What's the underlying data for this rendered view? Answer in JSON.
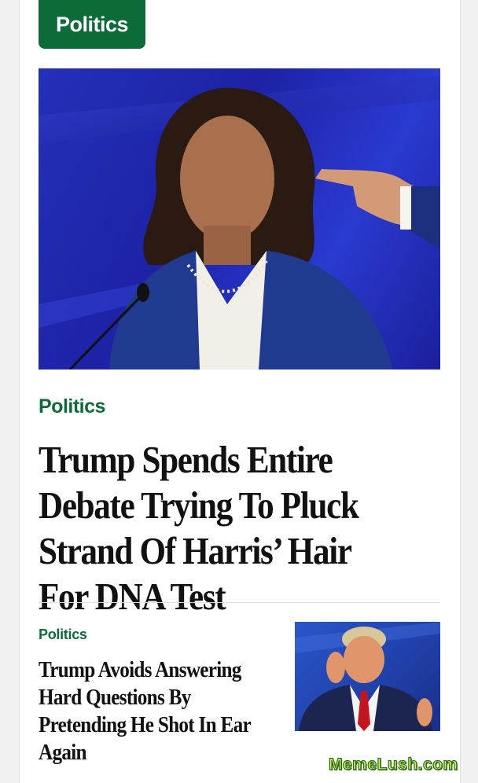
{
  "top_section_tag": "Politics",
  "lead_story": {
    "kicker": "Politics",
    "headline": "Trump Spends Entire Debate Trying To Pluck Strand Of Harris’ Hair For DNA Test"
  },
  "second_story": {
    "kicker": "Politics",
    "headline": "Trump Avoids Answering Hard Questions By Pretending He Shot In Ear Again"
  },
  "watermark": "MemeLush.com",
  "colors": {
    "accent_green": "#0d6b3a",
    "hero_background": "#2330b8",
    "text": "#111111"
  }
}
